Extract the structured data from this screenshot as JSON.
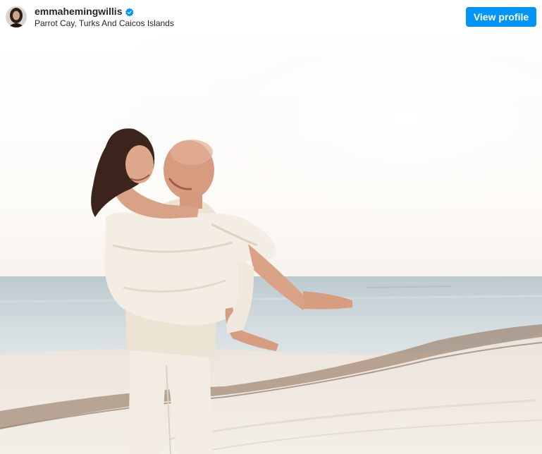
{
  "post": {
    "username": "emmahemingwillis",
    "verified": true,
    "location": "Parrot Cay, Turks And Caicos Islands",
    "view_profile_label": "View profile"
  },
  "icons": {
    "verified": "verified-badge-icon",
    "avatar": "profile-avatar"
  },
  "colors": {
    "button": "#0095f6",
    "verified": "#0095f6",
    "text": "#262626"
  },
  "photo": {
    "description_tag": "beach-wedding-photo"
  }
}
